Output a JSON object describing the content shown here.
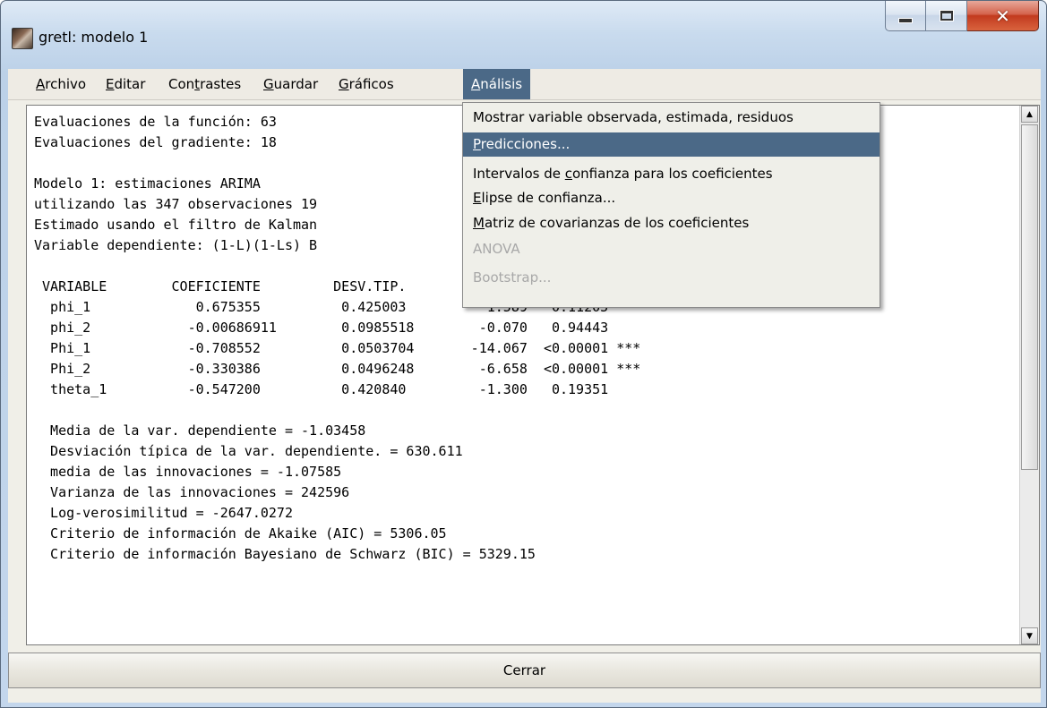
{
  "window": {
    "title": "gretl: modelo 1"
  },
  "menubar": {
    "items": [
      {
        "label": "Archivo",
        "accel": "A",
        "rest": "rchivo"
      },
      {
        "label": "Editar",
        "accel": "E",
        "rest": "ditar"
      },
      {
        "label": "Contrastes",
        "pre": "Con",
        "accel": "t",
        "rest": "rastes"
      },
      {
        "label": "Guardar",
        "accel": "G",
        "rest": "uardar"
      },
      {
        "label": "Gráficos",
        "accel": "G",
        "rest": "ráficos"
      },
      {
        "label": "Análisis",
        "accel": "A",
        "rest": "nálisis",
        "active": true
      }
    ]
  },
  "dropdown": {
    "items": [
      {
        "text": "Mostrar variable observada, estimada, residuos"
      },
      {
        "text": "Predicciones...",
        "accel": "P",
        "rest": "redicciones...",
        "highlighted": true
      },
      {
        "pre": "Intervalos de ",
        "accel": "c",
        "rest": "onfianza para los coeficientes"
      },
      {
        "accel": "E",
        "rest": "lipse de confianza..."
      },
      {
        "accel": "M",
        "rest": "atriz de covarianzas de los coeficientes"
      },
      {
        "text": "ANOVA",
        "disabled": true
      },
      {
        "text": "Bootstrap...",
        "disabled": true
      }
    ]
  },
  "output_text": "Evaluaciones de la función: 63\nEvaluaciones del gradiente: 18\n\nModelo 1: estimaciones ARIMA\nutilizando las 347 observaciones 19\nEstimado usando el filtro de Kalman\nVariable dependiente: (1-L)(1-Ls) B\n\n VARIABLE        COEFICIENTE         DESV.TIP.         ESTAD T   VALOR P\n  phi_1             0.675355          0.425003          1.589   0.11205\n  phi_2            -0.00686911        0.0985518        -0.070   0.94443\n  Phi_1            -0.708552          0.0503704       -14.067  <0.00001 ***\n  Phi_2            -0.330386          0.0496248        -6.658  <0.00001 ***\n  theta_1          -0.547200          0.420840         -1.300   0.19351\n\n  Media de la var. dependiente = -1.03458\n  Desviación típica de la var. dependiente. = 630.611\n  media de las innovaciones = -1.07585\n  Varianza de las innovaciones = 242596\n  Log-verosimilitud = -2647.0272\n  Criterio de información de Akaike (AIC) = 5306.05\n  Criterio de información Bayesiano de Schwarz (BIC) = 5329.15",
  "buttons": {
    "close_label": "Cerrar"
  },
  "colors": {
    "highlight": "#4b6987",
    "disabled_text": "#a8a8a8"
  },
  "icons": {
    "app": "gretl-app-icon",
    "minimize": "minimize-icon",
    "maximize": "maximize-icon",
    "close": "close-icon",
    "scroll_up": "scroll-up-arrow-icon",
    "scroll_down": "scroll-down-arrow-icon"
  }
}
